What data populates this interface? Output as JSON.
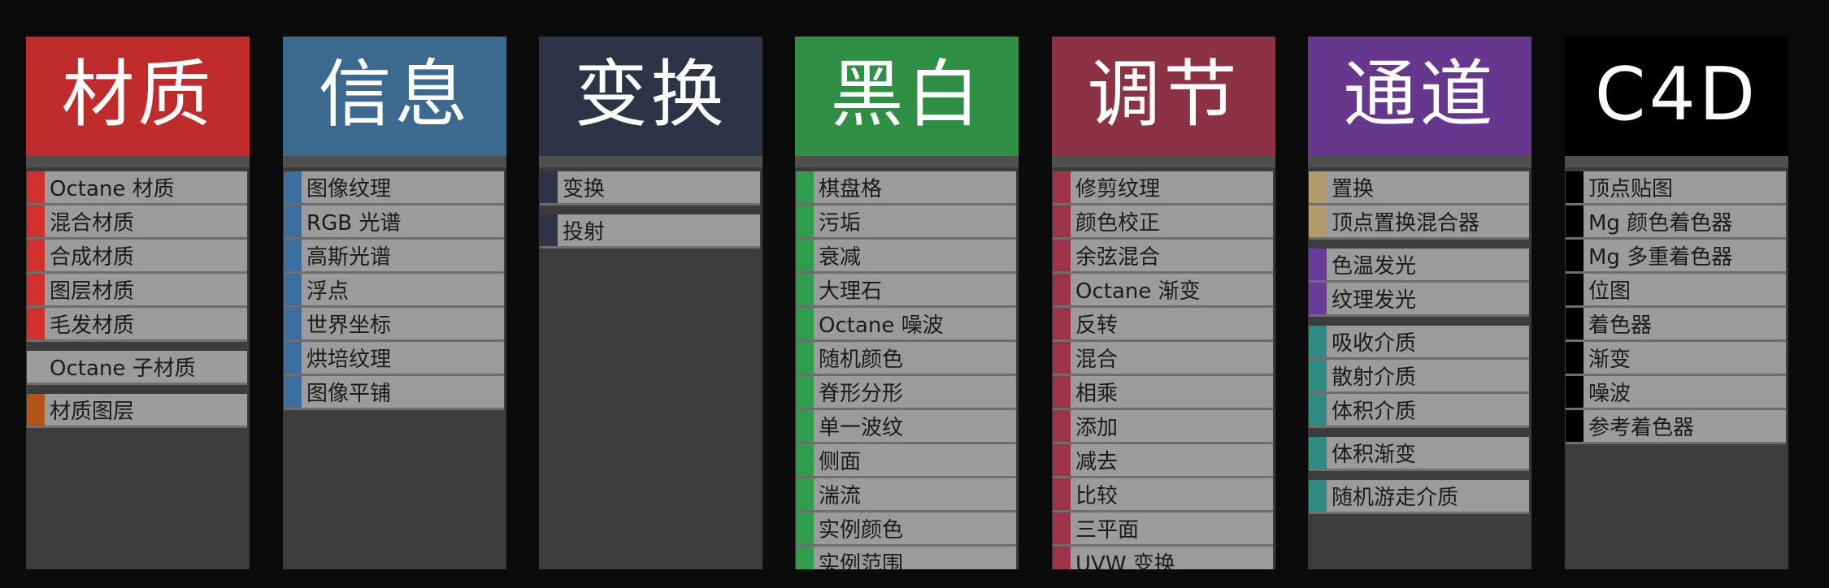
{
  "panels": [
    {
      "id": "material",
      "title": "材质",
      "header_color": "#c02b2b",
      "groups": [
        {
          "color": "#d2302a",
          "items": [
            "Octane 材质",
            "混合材质",
            "合成材质",
            "图层材质",
            "毛发材质"
          ]
        },
        {
          "color": "#9b9b9b",
          "items": [
            "Octane 子材质"
          ]
        },
        {
          "color": "#b3541a",
          "items": [
            "材质图层"
          ]
        }
      ]
    },
    {
      "id": "info",
      "title": "信息",
      "header_color": "#3b6990",
      "groups": [
        {
          "color": "#3a6f9f",
          "items": [
            "图像纹理",
            "RGB 光谱",
            "高斯光谱",
            "浮点",
            "世界坐标",
            "烘培纹理",
            "图像平铺"
          ]
        }
      ]
    },
    {
      "id": "transform",
      "title": "变换",
      "header_color": "#2e3445",
      "groups": [
        {
          "color": "#2e3445",
          "items": [
            "变换"
          ]
        },
        {
          "color": "#2e3445",
          "items": [
            "投射"
          ]
        }
      ]
    },
    {
      "id": "bw",
      "title": "黑白",
      "header_color": "#2f8f45",
      "groups": [
        {
          "color": "#2f9e4a",
          "items": [
            "棋盘格",
            "污垢",
            "衰减",
            "大理石",
            "Octane 噪波",
            "随机颜色",
            "脊形分形",
            "单一波纹",
            "侧面",
            "湍流",
            "实例颜色",
            "实例范围"
          ]
        }
      ]
    },
    {
      "id": "adjust",
      "title": "调节",
      "header_color": "#8b3345",
      "groups": [
        {
          "color": "#9c3348",
          "items": [
            "修剪纹理",
            "颜色校正",
            "余弦混合",
            "Octane 渐变",
            "反转",
            "混合",
            "相乘",
            "添加",
            "减去",
            "比较",
            "三平面",
            "UVW 变换"
          ]
        }
      ]
    },
    {
      "id": "channel",
      "title": "通道",
      "header_color": "#65378d",
      "groups": [
        {
          "color": "#b29a6a",
          "items": [
            "置换",
            "顶点置换混合器"
          ]
        },
        {
          "color": "#6a3c99",
          "items": [
            "色温发光",
            "纹理发光"
          ]
        },
        {
          "color": "#2f8a82",
          "items": [
            "吸收介质",
            "散射介质",
            "体积介质"
          ]
        },
        {
          "color": "#2f8a82",
          "items": [
            "体积渐变"
          ]
        },
        {
          "color": "#2f8a82",
          "items": [
            "随机游走介质"
          ]
        }
      ]
    },
    {
      "id": "c4d",
      "title": "C4D",
      "header_color": "#000000",
      "groups": [
        {
          "color": "#000000",
          "items": [
            "顶点贴图",
            "Mg 颜色着色器",
            "Mg 多重着色器",
            "位图",
            "着色器",
            "渐变",
            "噪波",
            "参考着色器"
          ]
        }
      ]
    }
  ]
}
